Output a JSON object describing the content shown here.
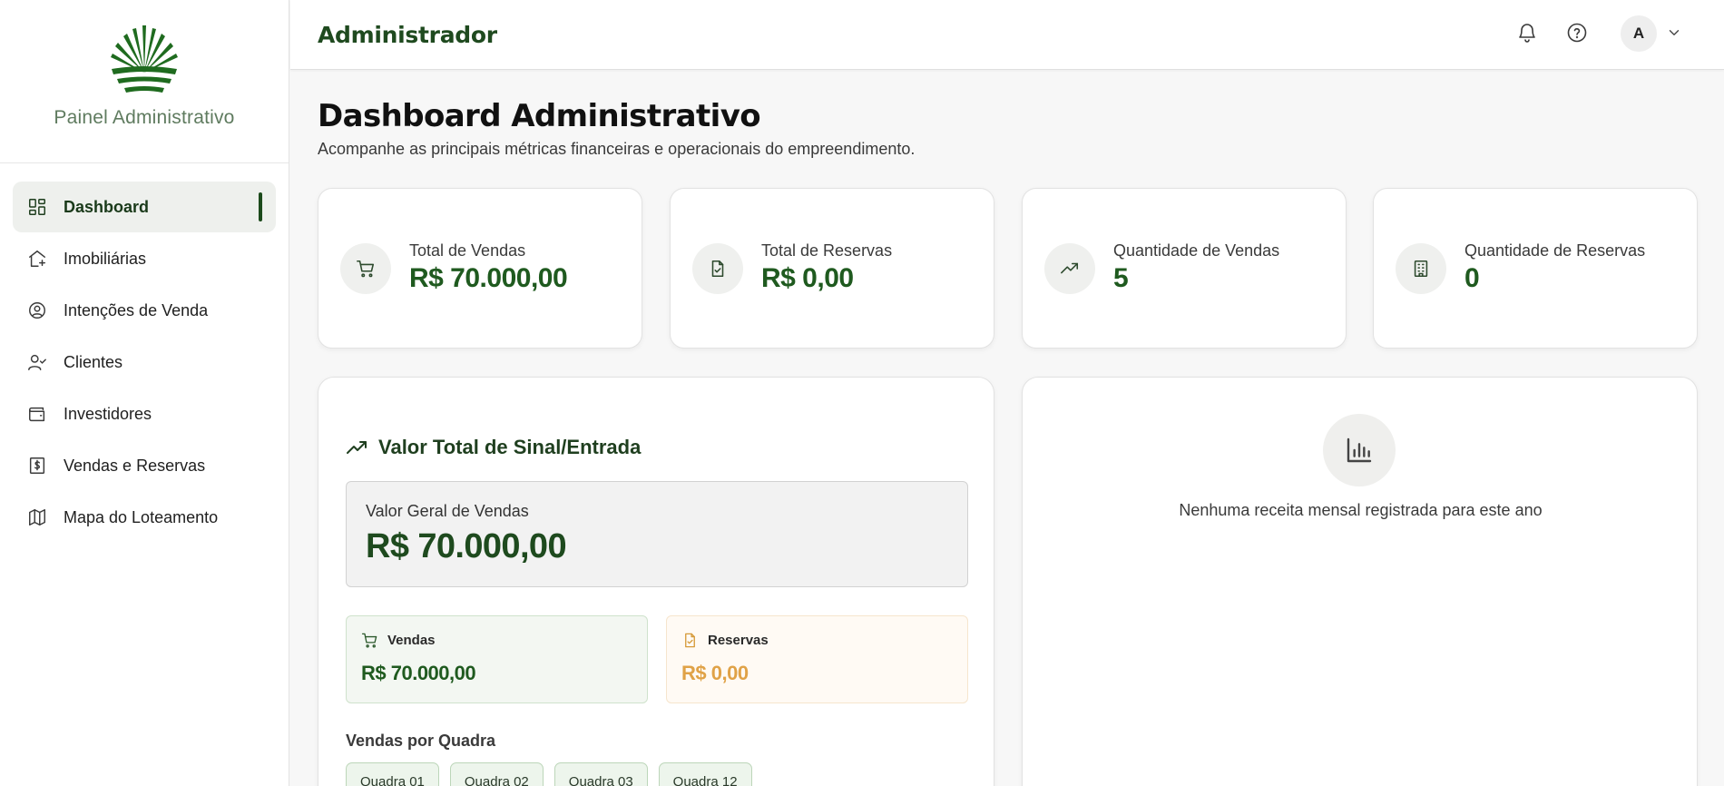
{
  "brand": {
    "title": "Painel Administrativo",
    "logo_icon": "fan-logo-icon",
    "color": "#1f6b1f"
  },
  "sidebar": {
    "items": [
      {
        "label": "Dashboard",
        "icon": "grid-icon",
        "active": true
      },
      {
        "label": "Imobiliárias",
        "icon": "house-plus-icon"
      },
      {
        "label": "Intenções de Venda",
        "icon": "user-circle-icon"
      },
      {
        "label": "Clientes",
        "icon": "user-check-icon"
      },
      {
        "label": "Investidores",
        "icon": "wallet-icon"
      },
      {
        "label": "Vendas e Reservas",
        "icon": "dollar-receipt-icon"
      },
      {
        "label": "Mapa do Loteamento",
        "icon": "map-icon"
      }
    ]
  },
  "header": {
    "title": "Administrador",
    "notification_icon": "bell-icon",
    "help_icon": "help-circle-icon",
    "avatar_initial": "A",
    "caret_icon": "chevron-down-icon"
  },
  "main": {
    "title": "Dashboard Administrativo",
    "subtitle": "Acompanhe as principais métricas financeiras e operacionais do empreendimento.",
    "stats": [
      {
        "label": "Total de Vendas",
        "value": "R$ 70.000,00",
        "icon": "cart-icon"
      },
      {
        "label": "Total de Reservas",
        "value": "R$ 0,00",
        "icon": "file-check-icon"
      },
      {
        "label": "Quantidade de Vendas",
        "value": "5",
        "icon": "trending-up-icon"
      },
      {
        "label": "Quantidade de Reservas",
        "value": "0",
        "icon": "building-icon"
      }
    ],
    "entrada": {
      "title": "Valor Total de Sinal/Entrada",
      "total_label": "Valor Geral de Vendas",
      "total_value": "R$ 70.000,00",
      "vendas_label": "Vendas",
      "vendas_value": "R$ 70.000,00",
      "reservas_label": "Reservas",
      "reservas_value": "R$ 0,00",
      "quadra_title": "Vendas por Quadra",
      "quadras": [
        "Quadra 01",
        "Quadra 02",
        "Quadra 03",
        "Quadra 12"
      ]
    },
    "receita": {
      "empty_message": "Nenhuma receita mensal registrada para este ano",
      "icon": "bar-chart-icon"
    }
  },
  "colors": {
    "primary": "#1f5a1f",
    "sidebar_active_bg": "#eef0ed",
    "reserva_accent": "#e0a247",
    "sales_card_bg": "#f3f7f2",
    "reserva_card_bg": "#fffaf4"
  }
}
